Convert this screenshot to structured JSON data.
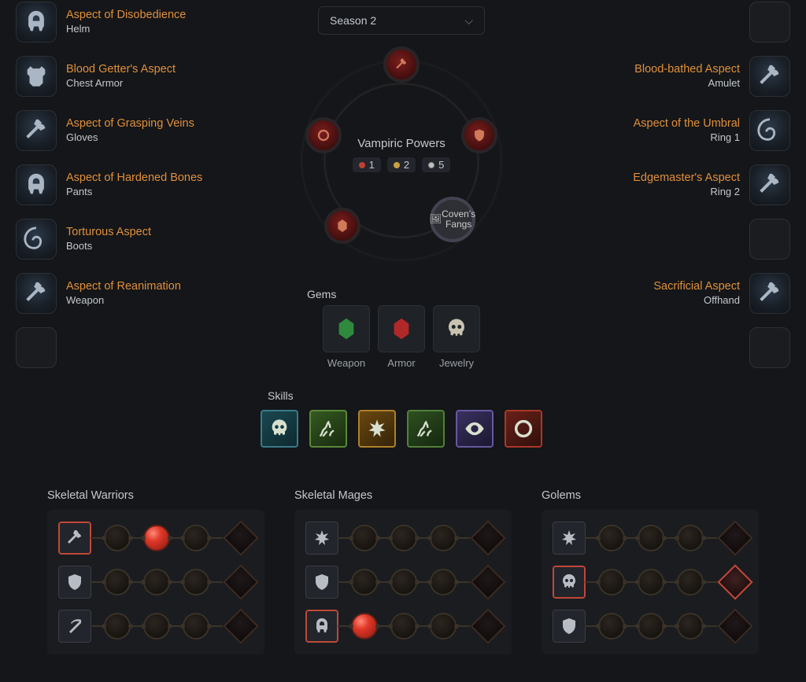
{
  "season_selector": {
    "label": "Season 2"
  },
  "left_slots": [
    {
      "aspect": "Aspect of Disobedience",
      "slot": "Helm",
      "icon": "helm"
    },
    {
      "aspect": "Blood Getter's Aspect",
      "slot": "Chest Armor",
      "icon": "chest"
    },
    {
      "aspect": "Aspect of Grasping Veins",
      "slot": "Gloves",
      "icon": "axe"
    },
    {
      "aspect": "Aspect of Hardened Bones",
      "slot": "Pants",
      "icon": "helm"
    },
    {
      "aspect": "Torturous Aspect",
      "slot": "Boots",
      "icon": "swirl"
    },
    {
      "aspect": "Aspect of Reanimation",
      "slot": "Weapon",
      "icon": "axe"
    },
    {
      "aspect": "",
      "slot": "",
      "icon": "empty"
    }
  ],
  "right_slots": [
    {
      "aspect": "",
      "slot": "",
      "icon": "empty"
    },
    {
      "aspect": "Blood-bathed Aspect",
      "slot": "Amulet",
      "icon": "axe"
    },
    {
      "aspect": "Aspect of the Umbral",
      "slot": "Ring 1",
      "icon": "swirl"
    },
    {
      "aspect": "Edgemaster's Aspect",
      "slot": "Ring 2",
      "icon": "axe"
    },
    {
      "aspect": "",
      "slot": "",
      "icon": "empty"
    },
    {
      "aspect": "Sacrificial Aspect",
      "slot": "Offhand",
      "icon": "axe"
    },
    {
      "aspect": "",
      "slot": "",
      "icon": "empty"
    }
  ],
  "vampiric": {
    "title": "Vampiric Powers",
    "stats": [
      {
        "color": "r",
        "value": "1"
      },
      {
        "color": "y",
        "value": "2"
      },
      {
        "color": "w",
        "value": "5"
      }
    ],
    "node5_text": "Coven's Fangs"
  },
  "gems": {
    "title": "Gems",
    "items": [
      {
        "label": "Weapon",
        "type": "emerald"
      },
      {
        "label": "Armor",
        "type": "ruby"
      },
      {
        "label": "Jewelry",
        "type": "skull"
      }
    ]
  },
  "skills": {
    "title": "Skills",
    "list": [
      {
        "class": "sk-teal"
      },
      {
        "class": "sk-green1"
      },
      {
        "class": "sk-yellow"
      },
      {
        "class": "sk-green2"
      },
      {
        "class": "sk-purple"
      },
      {
        "class": "sk-red"
      }
    ]
  },
  "army": [
    {
      "title": "Skeletal Warriors",
      "rows": [
        {
          "icon_sel": true,
          "orbs": [
            false,
            true,
            false
          ],
          "diamond_sel": false
        },
        {
          "icon_sel": false,
          "orbs": [
            false,
            false,
            false
          ],
          "diamond_sel": false
        },
        {
          "icon_sel": false,
          "orbs": [
            false,
            false,
            false
          ],
          "diamond_sel": false
        }
      ]
    },
    {
      "title": "Skeletal Mages",
      "rows": [
        {
          "icon_sel": false,
          "orbs": [
            false,
            false,
            false
          ],
          "diamond_sel": false
        },
        {
          "icon_sel": false,
          "orbs": [
            false,
            false,
            false
          ],
          "diamond_sel": false
        },
        {
          "icon_sel": true,
          "orbs": [
            true,
            false,
            false
          ],
          "diamond_sel": false
        }
      ]
    },
    {
      "title": "Golems",
      "rows": [
        {
          "icon_sel": false,
          "orbs": [
            false,
            false,
            false
          ],
          "diamond_sel": false
        },
        {
          "icon_sel": true,
          "orbs": [
            false,
            false,
            false
          ],
          "diamond_sel": true
        },
        {
          "icon_sel": false,
          "orbs": [
            false,
            false,
            false
          ],
          "diamond_sel": false
        }
      ]
    }
  ]
}
